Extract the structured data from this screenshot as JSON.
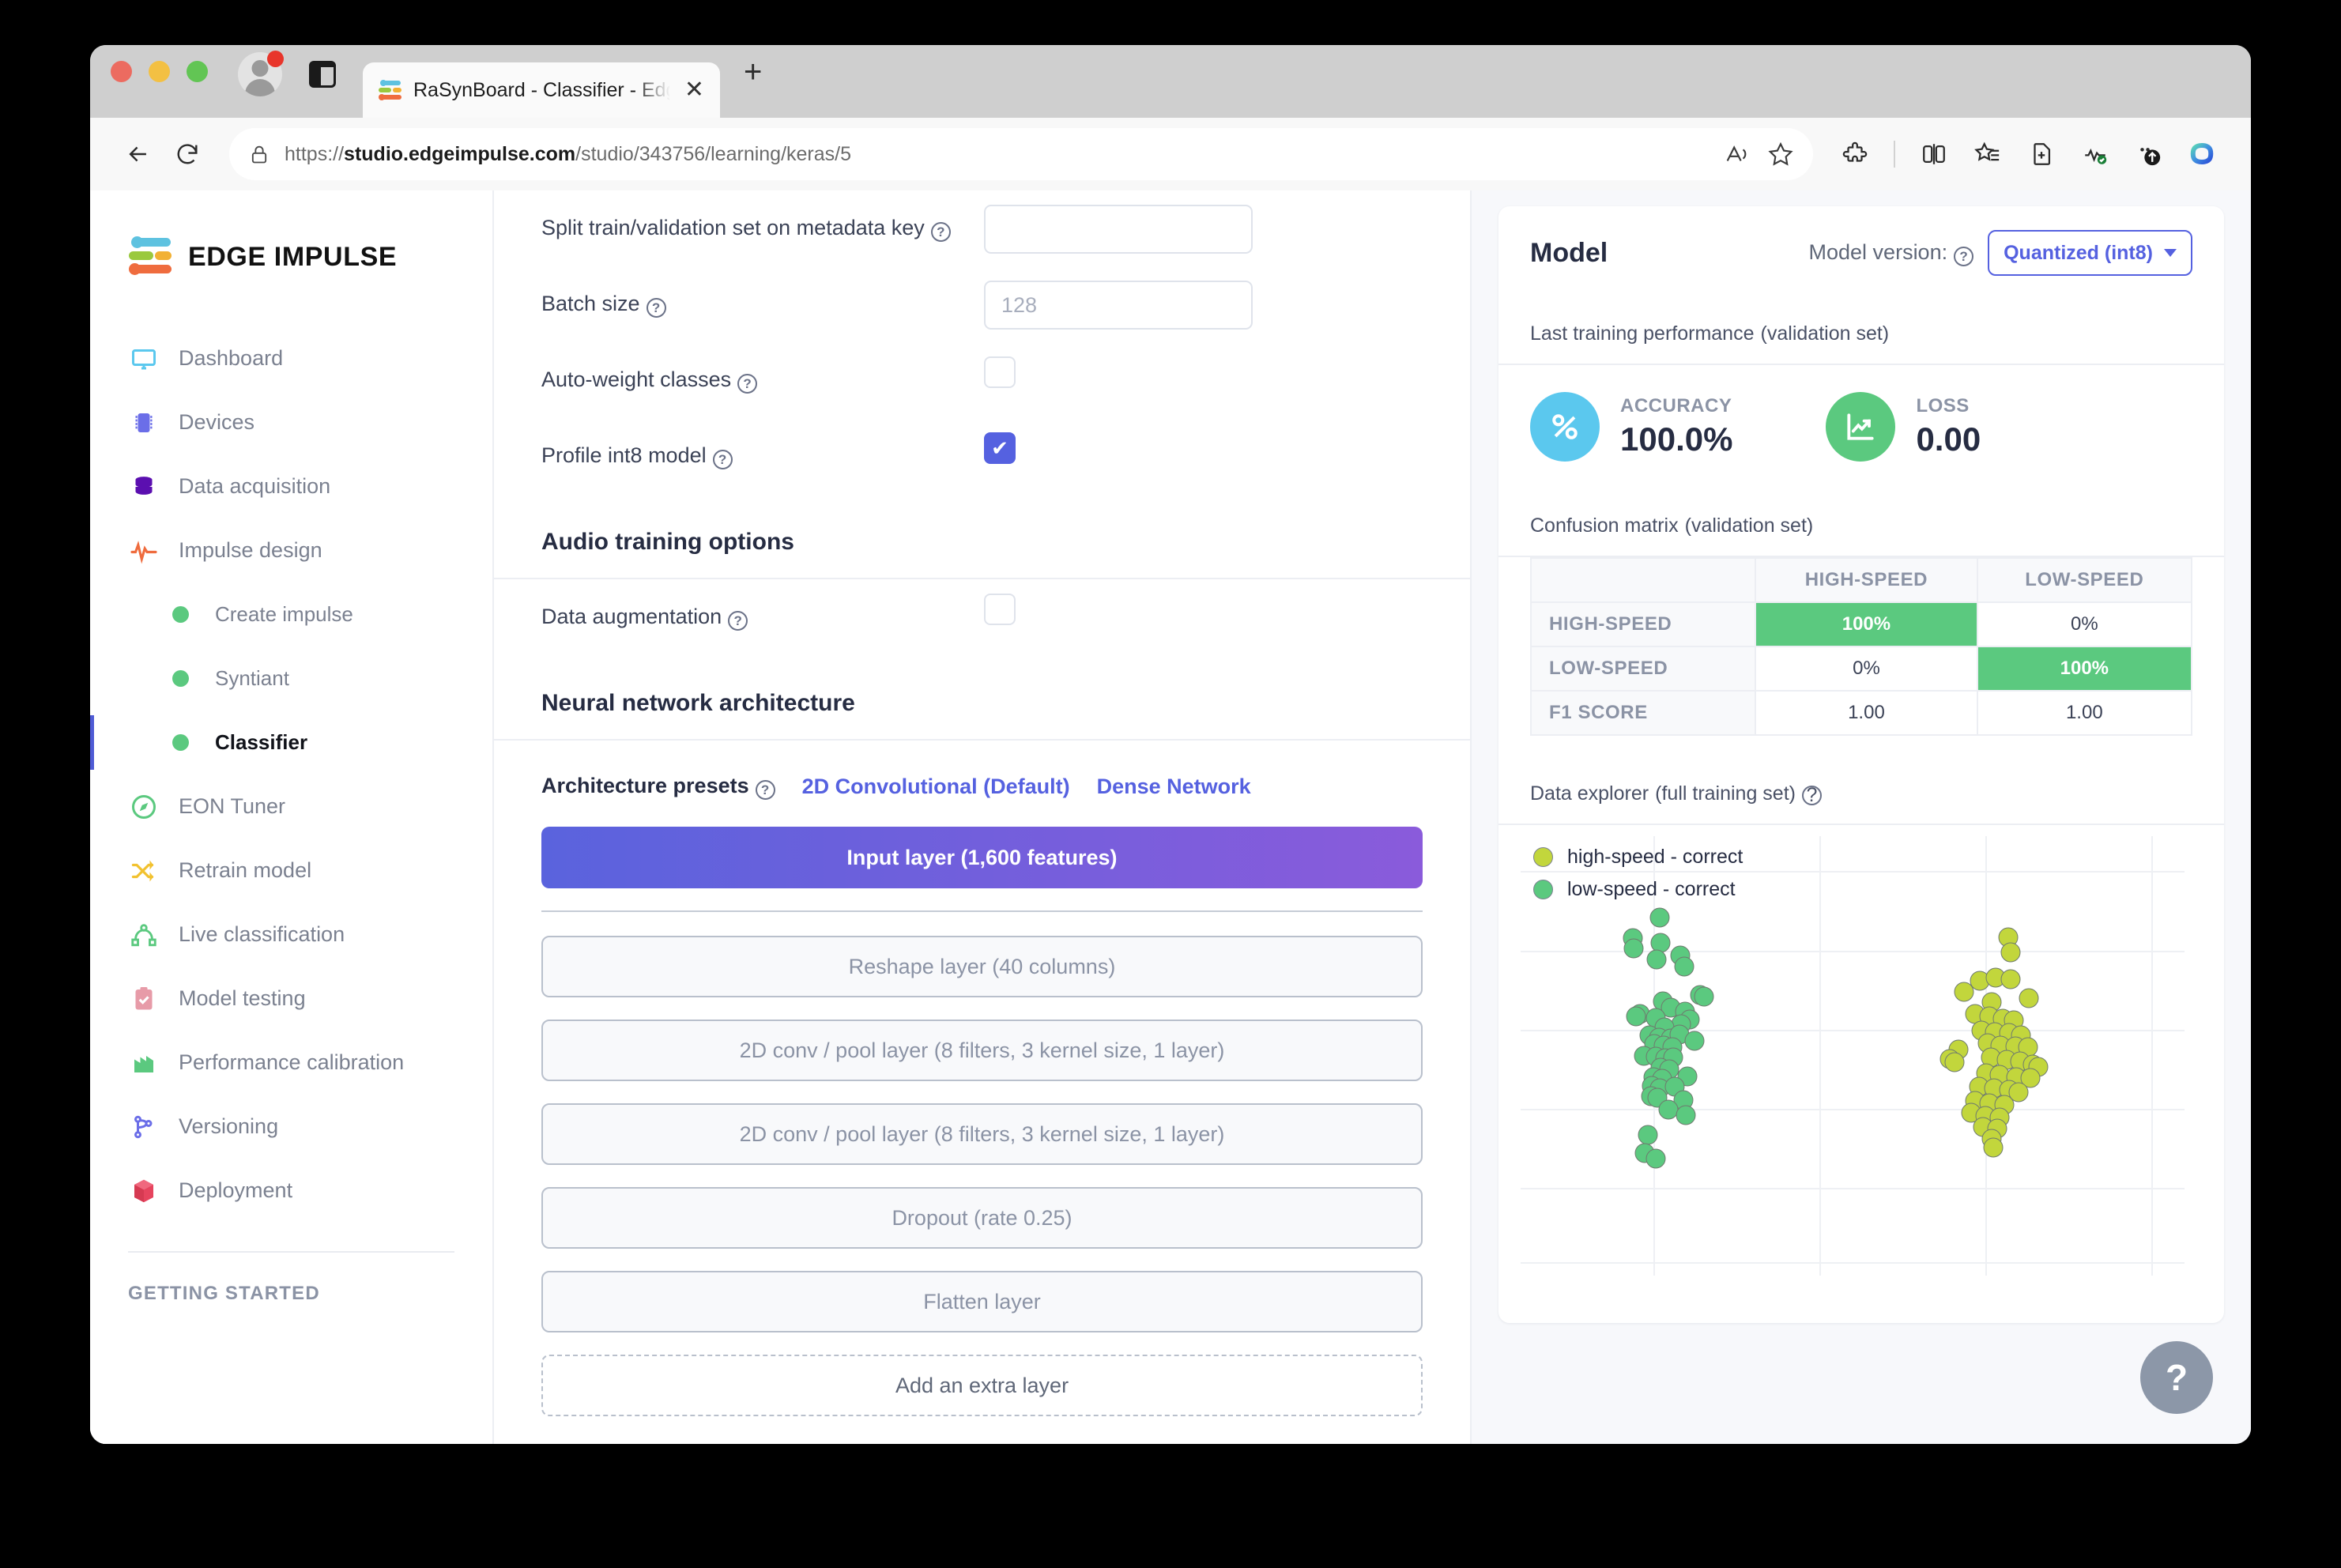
{
  "browser": {
    "tab_title": "RaSynBoard - Classifier - Edge",
    "tab_close_glyph": "✕",
    "new_tab_glyph": "+",
    "url_scheme": "https://",
    "url_host": "studio.edgeimpulse.com",
    "url_path": "/studio/343756/learning/keras/5"
  },
  "sidebar": {
    "brand": "EDGE IMPULSE",
    "items": [
      {
        "label": "Dashboard",
        "icon": "monitor-icon",
        "type": "top"
      },
      {
        "label": "Devices",
        "icon": "chip-icon",
        "type": "top"
      },
      {
        "label": "Data acquisition",
        "icon": "database-icon",
        "type": "top"
      },
      {
        "label": "Impulse design",
        "icon": "pulse-icon",
        "type": "top"
      },
      {
        "label": "Create impulse",
        "icon": "bullet-icon",
        "type": "sub"
      },
      {
        "label": "Syntiant",
        "icon": "bullet-icon",
        "type": "sub"
      },
      {
        "label": "Classifier",
        "icon": "bullet-icon",
        "type": "sub",
        "active": true
      },
      {
        "label": "EON Tuner",
        "icon": "compass-icon",
        "type": "top"
      },
      {
        "label": "Retrain model",
        "icon": "shuffle-icon",
        "type": "top"
      },
      {
        "label": "Live classification",
        "icon": "network-icon",
        "type": "top"
      },
      {
        "label": "Model testing",
        "icon": "clipboard-check-icon",
        "type": "top"
      },
      {
        "label": "Performance calibration",
        "icon": "bar-chart-icon",
        "type": "top"
      },
      {
        "label": "Versioning",
        "icon": "branch-icon",
        "type": "top"
      },
      {
        "label": "Deployment",
        "icon": "cube-icon",
        "type": "top"
      }
    ],
    "section_label": "GETTING STARTED"
  },
  "training": {
    "fields": [
      {
        "label": "Split train/validation set on metadata key",
        "value": "",
        "type": "text"
      },
      {
        "label": "Batch size",
        "value": "128",
        "type": "text"
      },
      {
        "label": "Auto-weight classes",
        "checked": false,
        "type": "checkbox"
      },
      {
        "label": "Profile int8 model",
        "checked": true,
        "type": "checkbox"
      }
    ],
    "audio_section_title": "Audio training options",
    "audio_fields": [
      {
        "label": "Data augmentation",
        "checked": false,
        "type": "checkbox"
      }
    ],
    "nn_section_title": "Neural network architecture",
    "presets_label": "Architecture presets",
    "presets": [
      "2D Convolutional (Default)",
      "Dense Network"
    ],
    "layers": [
      {
        "label": "Input layer (1,600 features)",
        "style": "input"
      },
      {
        "label": "Reshape layer (40 columns)",
        "style": "plain"
      },
      {
        "label": "2D conv / pool layer (8 filters, 3 kernel size, 1 layer)",
        "style": "plain"
      },
      {
        "label": "2D conv / pool layer (8 filters, 3 kernel size, 1 layer)",
        "style": "plain"
      },
      {
        "label": "Dropout (rate 0.25)",
        "style": "plain"
      },
      {
        "label": "Flatten layer",
        "style": "plain"
      },
      {
        "label": "Add an extra layer",
        "style": "dashed"
      }
    ]
  },
  "model": {
    "title": "Model",
    "version_label": "Model version:",
    "version_value": "Quantized (int8)",
    "perf_title": "Last training performance",
    "perf_subtitle": "(validation set)",
    "accuracy_label": "ACCURACY",
    "accuracy_value": "100.0%",
    "loss_label": "LOSS",
    "loss_value": "0.00",
    "cm_title": "Confusion matrix",
    "cm_subtitle": "(validation set)",
    "explorer_title": "Data explorer",
    "explorer_subtitle": "(full training set)"
  },
  "chart_data": [
    {
      "type": "table",
      "title": "Confusion matrix (validation set)",
      "columns": [
        "",
        "HIGH-SPEED",
        "LOW-SPEED"
      ],
      "rows": [
        {
          "header": "HIGH-SPEED",
          "cells": [
            {
              "value": "100%",
              "highlight": true
            },
            {
              "value": "0%",
              "highlight": false
            }
          ]
        },
        {
          "header": "LOW-SPEED",
          "cells": [
            {
              "value": "0%",
              "highlight": false
            },
            {
              "value": "100%",
              "highlight": true
            }
          ]
        },
        {
          "header": "F1 SCORE",
          "cells": [
            {
              "value": "1.00",
              "highlight": false
            },
            {
              "value": "1.00",
              "highlight": false
            }
          ]
        }
      ]
    },
    {
      "type": "scatter",
      "title": "Data explorer (full training set)",
      "xlabel": "",
      "ylabel": "",
      "grid": true,
      "legend_position": "top-left",
      "xlim": [
        0,
        100
      ],
      "ylim": [
        0,
        100
      ],
      "series": [
        {
          "name": "high-speed - correct",
          "color": "#c2d63c",
          "points": [
            [
              73.5,
              23.0
            ],
            [
              73.8,
              26.5
            ],
            [
              69.2,
              33.0
            ],
            [
              71.6,
              32.2
            ],
            [
              73.8,
              32.6
            ],
            [
              66.8,
              35.5
            ],
            [
              71.0,
              37.7
            ],
            [
              76.6,
              36.8
            ],
            [
              68.4,
              40.5
            ],
            [
              70.6,
              41.0
            ],
            [
              72.6,
              41.6
            ],
            [
              74.3,
              41.9
            ],
            [
              69.4,
              44.2
            ],
            [
              71.4,
              44.6
            ],
            [
              73.6,
              44.8
            ],
            [
              75.3,
              45.3
            ],
            [
              70.4,
              47.1
            ],
            [
              72.3,
              47.7
            ],
            [
              74.5,
              47.9
            ],
            [
              76.4,
              48.0
            ],
            [
              65.9,
              48.6
            ],
            [
              64.6,
              50.8
            ],
            [
              65.4,
              51.4
            ],
            [
              70.8,
              50.4
            ],
            [
              73.2,
              50.9
            ],
            [
              75.2,
              51.3
            ],
            [
              77.1,
              51.9
            ],
            [
              78.0,
              52.5
            ],
            [
              70.1,
              54.0
            ],
            [
              72.2,
              54.4
            ],
            [
              74.6,
              54.8
            ],
            [
              76.8,
              55.1
            ],
            [
              69.0,
              57.0
            ],
            [
              71.3,
              57.4
            ],
            [
              73.6,
              57.8
            ],
            [
              75.0,
              58.2
            ],
            [
              68.4,
              60.3
            ],
            [
              70.6,
              60.8
            ],
            [
              72.8,
              61.2
            ],
            [
              67.9,
              63.0
            ],
            [
              70.0,
              63.6
            ],
            [
              72.2,
              64.0
            ],
            [
              69.6,
              66.2
            ],
            [
              71.8,
              66.6
            ],
            [
              70.9,
              68.9
            ],
            [
              71.2,
              70.8
            ]
          ]
        },
        {
          "name": "low-speed - correct",
          "color": "#5bc97f",
          "points": [
            [
              21.0,
              18.6
            ],
            [
              16.9,
              23.2
            ],
            [
              17.0,
              25.6
            ],
            [
              21.1,
              24.3
            ],
            [
              20.5,
              28.0
            ],
            [
              24.1,
              27.2
            ],
            [
              24.6,
              29.7
            ],
            [
              27.0,
              36.1
            ],
            [
              27.6,
              36.6
            ],
            [
              21.4,
              37.6
            ],
            [
              22.6,
              39.0
            ],
            [
              18.0,
              40.5
            ],
            [
              17.4,
              41.0
            ],
            [
              20.3,
              41.3
            ],
            [
              24.8,
              40.0
            ],
            [
              25.5,
              41.8
            ],
            [
              24.2,
              42.8
            ],
            [
              21.7,
              43.5
            ],
            [
              19.4,
              45.4
            ],
            [
              20.8,
              45.8
            ],
            [
              22.6,
              46.0
            ],
            [
              23.9,
              45.2
            ],
            [
              26.2,
              46.6
            ],
            [
              20.1,
              47.3
            ],
            [
              21.5,
              47.6
            ],
            [
              22.9,
              48.0
            ],
            [
              18.6,
              50.0
            ],
            [
              20.4,
              50.2
            ],
            [
              21.8,
              50.6
            ],
            [
              23.0,
              50.4
            ],
            [
              21.1,
              52.7
            ],
            [
              22.4,
              53.0
            ],
            [
              20.0,
              54.8
            ],
            [
              21.3,
              55.2
            ],
            [
              25.1,
              54.6
            ],
            [
              19.8,
              56.9
            ],
            [
              20.9,
              57.3
            ],
            [
              23.2,
              57.0
            ],
            [
              19.6,
              59.1
            ],
            [
              20.6,
              59.5
            ],
            [
              24.5,
              60.0
            ],
            [
              22.3,
              62.2
            ],
            [
              24.9,
              63.4
            ],
            [
              19.2,
              68.0
            ],
            [
              18.7,
              72.2
            ],
            [
              20.4,
              73.4
            ]
          ]
        }
      ]
    }
  ],
  "help": {
    "glyph": "?"
  }
}
